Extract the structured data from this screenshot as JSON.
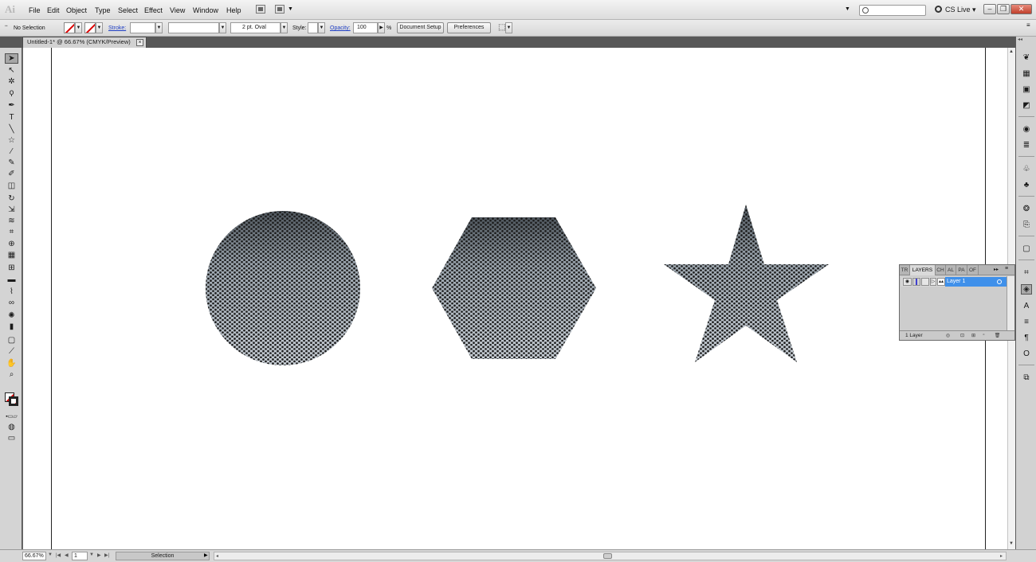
{
  "app": {
    "logo": "Ai"
  },
  "menubar": {
    "items": [
      "File",
      "Edit",
      "Object",
      "Type",
      "Select",
      "Effect",
      "View",
      "Window",
      "Help"
    ],
    "search_placeholder": "",
    "cs_live": "CS Live ▾"
  },
  "controlbar": {
    "selection": "No Selection",
    "stroke_label": "Stroke:",
    "brush": "2 pt. Oval",
    "style_label": "Style:",
    "opacity_label": "Opacity:",
    "opacity_value": "100",
    "percent": "%",
    "document_setup": "Document Setup",
    "preferences": "Preferences"
  },
  "document": {
    "tab_title": "Untitled-1* @ 66.67% (CMYK/Preview)",
    "tab_close": "×"
  },
  "tools": [
    {
      "name": "selection-tool",
      "glyph": "➤"
    },
    {
      "name": "direct-selection-tool",
      "glyph": "↖"
    },
    {
      "name": "magic-wand-tool",
      "glyph": "✲"
    },
    {
      "name": "lasso-tool",
      "glyph": "ϙ"
    },
    {
      "name": "pen-tool",
      "glyph": "✒"
    },
    {
      "name": "type-tool",
      "glyph": "T"
    },
    {
      "name": "line-tool",
      "glyph": "╲"
    },
    {
      "name": "shape-tool",
      "glyph": "☆"
    },
    {
      "name": "paintbrush-tool",
      "glyph": "⁄"
    },
    {
      "name": "pencil-tool",
      "glyph": "✎"
    },
    {
      "name": "blob-brush-tool",
      "glyph": "✐"
    },
    {
      "name": "eraser-tool",
      "glyph": "◫"
    },
    {
      "name": "rotate-tool",
      "glyph": "↻"
    },
    {
      "name": "scale-tool",
      "glyph": "⇲"
    },
    {
      "name": "warp-tool",
      "glyph": "≋"
    },
    {
      "name": "free-transform-tool",
      "glyph": "⌗"
    },
    {
      "name": "shape-builder-tool",
      "glyph": "⊕"
    },
    {
      "name": "perspective-grid-tool",
      "glyph": "▦"
    },
    {
      "name": "mesh-tool",
      "glyph": "⊞"
    },
    {
      "name": "gradient-tool",
      "glyph": "▬"
    },
    {
      "name": "eyedropper-tool",
      "glyph": "⌇"
    },
    {
      "name": "blend-tool",
      "glyph": "∞"
    },
    {
      "name": "symbol-sprayer-tool",
      "glyph": "✺"
    },
    {
      "name": "column-graph-tool",
      "glyph": "▮"
    },
    {
      "name": "artboard-tool",
      "glyph": "▢"
    },
    {
      "name": "slice-tool",
      "glyph": "⟋"
    },
    {
      "name": "hand-tool",
      "glyph": "✋"
    },
    {
      "name": "zoom-tool",
      "glyph": "⌕"
    }
  ],
  "dock_icons": [
    "color-guide-icon",
    "swatches-icon",
    "gradient-icon",
    "transparency-icon",
    "appearance-icon",
    "stroke-icon",
    "symbols-icon",
    "brushes-icon",
    "graphic-styles-icon",
    "links-icon",
    "artboards-icon",
    "transform-icon",
    "layers-icon",
    "character-icon",
    "align-icon",
    "paragraph-icon",
    "opentype-icon",
    "pathfinder-icon"
  ],
  "layers_panel": {
    "tabs": [
      "TR",
      "LAYERS",
      "CH",
      "AL",
      "PA",
      "OF"
    ],
    "layer_name": "Layer 1",
    "count": "1 Layer"
  },
  "statusbar": {
    "zoom": "66.67%",
    "artboard": "1",
    "status": "Selection"
  },
  "colors": {
    "accent": "#3f90ea",
    "shape_dark": "#1c1c1c",
    "shape_light": "#b9c3cc"
  }
}
